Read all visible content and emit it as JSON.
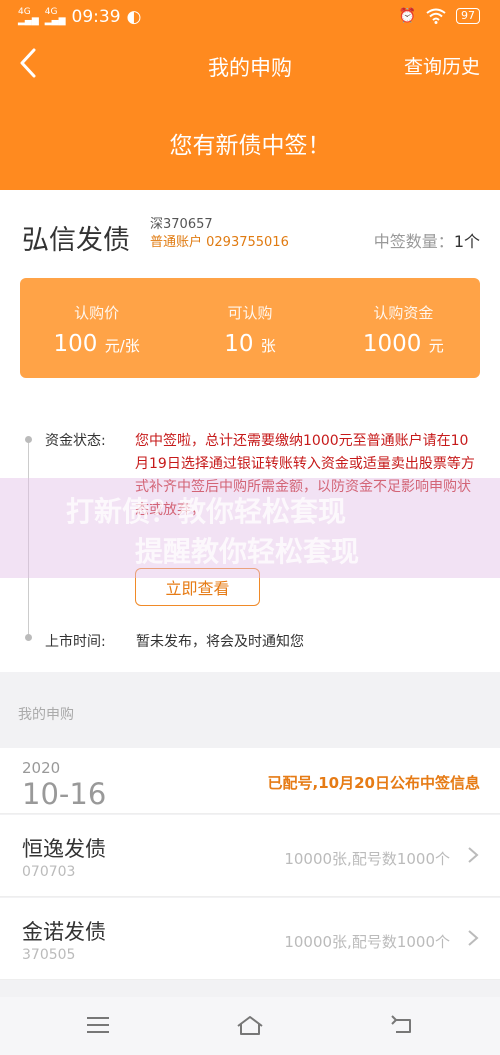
{
  "status_bar": {
    "network1": "4G",
    "network2": "4G",
    "time": "09:39",
    "battery": "97"
  },
  "header": {
    "title": "我的申购",
    "history_link": "查询历史",
    "banner": "您有新债中签！"
  },
  "bond": {
    "name": "弘信发债",
    "code": "深370657",
    "account": "普通账户 0293755016",
    "win_label": "中签数量：",
    "win_count": "1个"
  },
  "summary": [
    {
      "label": "认购价",
      "value": "100",
      "unit": "元/张"
    },
    {
      "label": "可认购",
      "value": "10",
      "unit": "张"
    },
    {
      "label": "认购资金",
      "value": "1000",
      "unit": "元"
    }
  ],
  "timeline": {
    "fund_status_label": "资金状态:",
    "fund_status_text": "您中签啦，总计还需要缴纳1000元至普通账户请在10月19日选择通过银证转账转入资金或适量卖出股票等方式补齐中签后中购所需金额，以防资金不足影响申购状态或放弃，",
    "view_button": "立即查看",
    "listing_label": "上市时间:",
    "listing_text": "暂未发布，将会及时通知您"
  },
  "watermark": {
    "line1": "打新债？教你轻松套现",
    "line2": "提醒教你轻松套现"
  },
  "section": {
    "title": "我的申购"
  },
  "date_group": {
    "year": "2020",
    "day": "10-16",
    "status": "已配号,10月20日公布中签信息"
  },
  "items": [
    {
      "name": "恒逸发债",
      "code": "070703",
      "info": "10000张,配号数1000个"
    },
    {
      "name": "金诺发债",
      "code": "370505",
      "info": "10000张,配号数1000个"
    }
  ],
  "colors": {
    "primary": "#ff8a1f",
    "summary_bg": "#ffa347",
    "alert_red": "#c61a1a",
    "accent_text": "#e67b15"
  }
}
